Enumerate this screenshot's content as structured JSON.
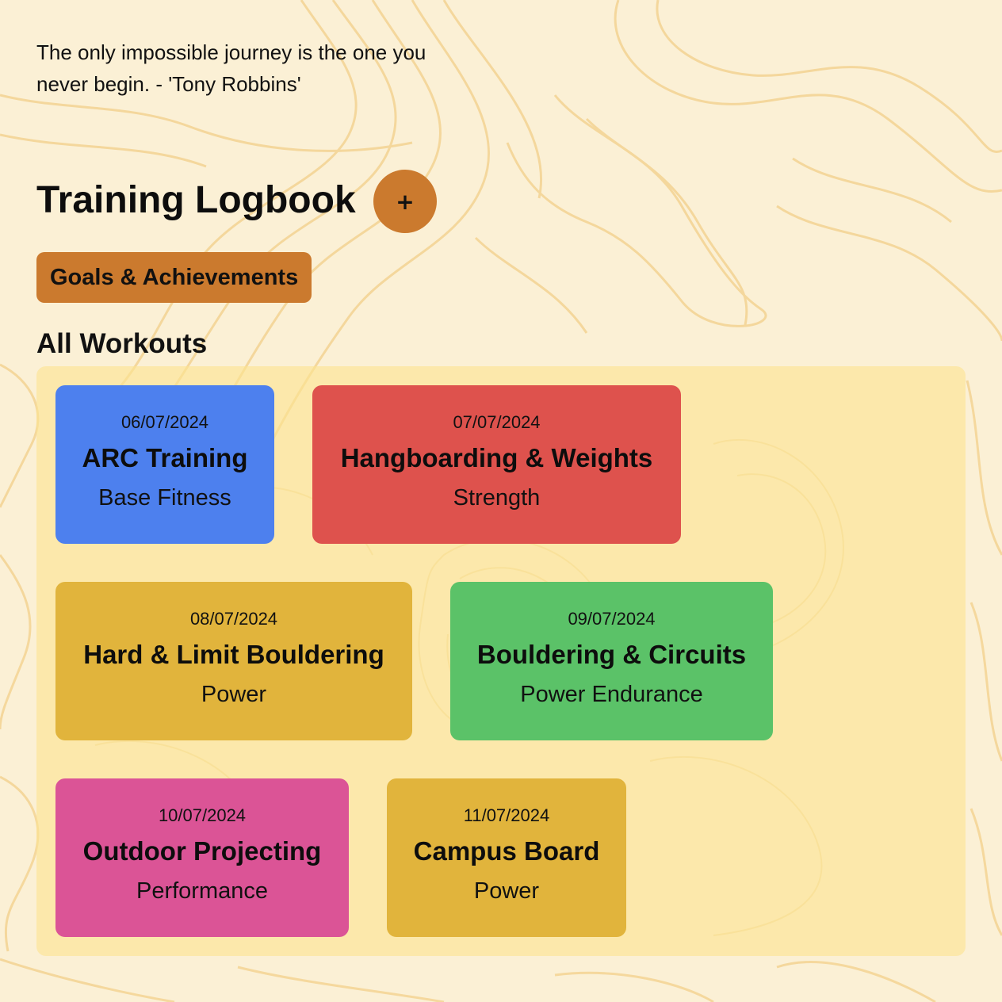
{
  "quote": {
    "text": "The only impossible journey is the one you never begin. - 'Tony Robbins'"
  },
  "header": {
    "title": "Training Logbook",
    "add_label": "+"
  },
  "goals_button": {
    "label": "Goals & Achievements"
  },
  "workouts": {
    "section_title": "All Workouts",
    "items": [
      {
        "date": "06/07/2024",
        "title": "ARC Training",
        "category": "Base Fitness",
        "color": "#4d80ee"
      },
      {
        "date": "07/07/2024",
        "title": "Hangboarding & Weights",
        "category": "Strength",
        "color": "#de524d"
      },
      {
        "date": "08/07/2024",
        "title": "Hard & Limit Bouldering",
        "category": "Power",
        "color": "#e1b43c"
      },
      {
        "date": "09/07/2024",
        "title": "Bouldering & Circuits",
        "category": "Power Endurance",
        "color": "#5bc268"
      },
      {
        "date": "10/07/2024",
        "title": "Outdoor Projecting",
        "category": "Performance",
        "color": "#db5496"
      },
      {
        "date": "11/07/2024",
        "title": "Campus Board",
        "category": "Power",
        "color": "#e1b43c"
      }
    ]
  },
  "colors": {
    "accent": "#cb7a2e",
    "background": "#fbf0d5",
    "panel": "#fbe7a3",
    "topo_lines": "#f3d393"
  }
}
